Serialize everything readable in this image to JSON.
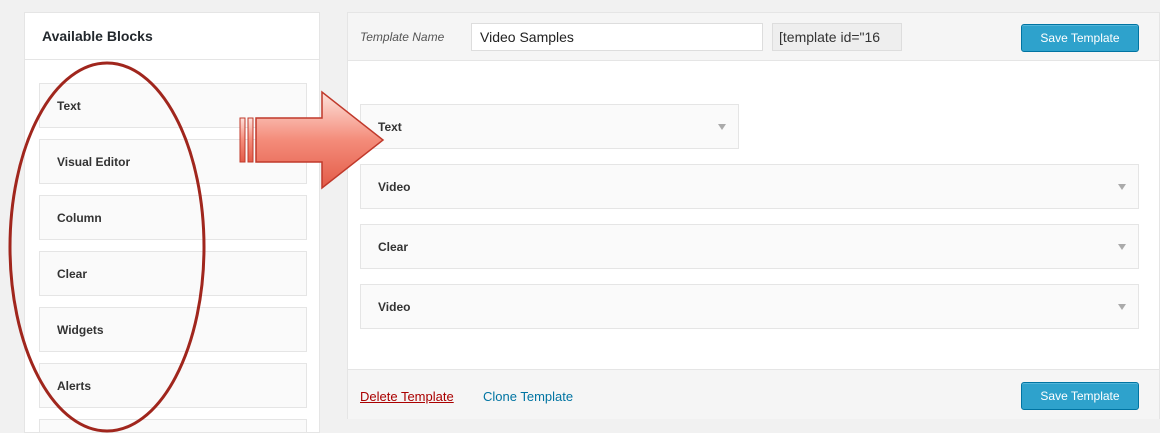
{
  "sidebar": {
    "title": "Available Blocks",
    "blocks": [
      {
        "label": "Text"
      },
      {
        "label": "Visual Editor"
      },
      {
        "label": "Column"
      },
      {
        "label": "Clear"
      },
      {
        "label": "Widgets"
      },
      {
        "label": "Alerts"
      }
    ]
  },
  "header": {
    "template_name_label": "Template Name",
    "template_name_value": "Video Samples",
    "shortcode": "[template id=\"16",
    "save_label": "Save Template"
  },
  "template_blocks": [
    {
      "label": "Text"
    },
    {
      "label": "Video"
    },
    {
      "label": "Clear"
    },
    {
      "label": "Video"
    }
  ],
  "footer": {
    "delete_label": "Delete Template",
    "clone_label": "Clone Template",
    "save_label": "Save Template"
  },
  "colors": {
    "primary_button": "#2ea2cc",
    "delete_link": "#aa0000",
    "clone_link": "#0074a2",
    "annotation_stroke": "#a0261d",
    "arrow_fill": "#f07a6a"
  },
  "icons": [
    "chevron-down-icon",
    "annotation-ellipse",
    "annotation-arrow"
  ]
}
